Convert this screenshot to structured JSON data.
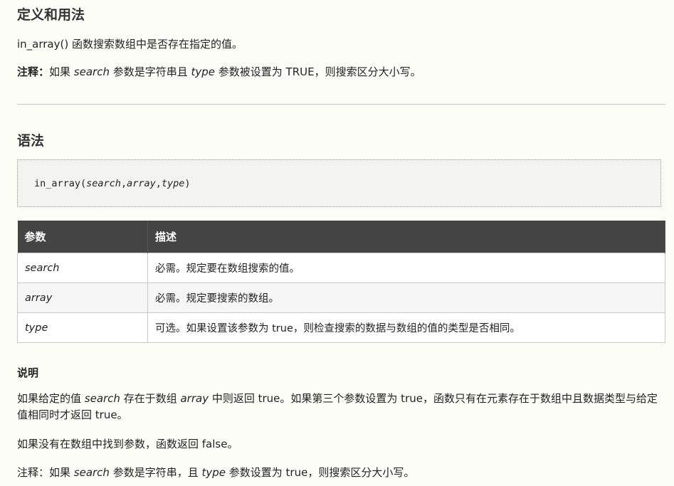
{
  "definition": {
    "heading": "定义和用法",
    "intro": "in_array() 函数搜索数组中是否存在指定的值。",
    "note": {
      "label": "注释：",
      "part1": "如果 ",
      "search": "search",
      "part2": " 参数是字符串且 ",
      "type": "type",
      "part3": " 参数被设置为 TRUE，则搜索区分大小写。"
    }
  },
  "syntax": {
    "heading": "语法",
    "code": {
      "fn": "in_array(",
      "arg1": "search",
      "sep1": ",",
      "arg2": "array",
      "sep2": ",",
      "arg3": "type",
      "close": ")"
    }
  },
  "params_table": {
    "headers": [
      "参数",
      "描述"
    ],
    "rows": [
      {
        "name": "search",
        "desc": "必需。规定要在数组搜索的值。"
      },
      {
        "name": "array",
        "desc": "必需。规定要搜索的数组。"
      },
      {
        "name": "type",
        "desc": "可选。如果设置该参数为 true，则检查搜索的数据与数组的值的类型是否相同。"
      }
    ]
  },
  "description": {
    "heading": "说明",
    "p1": {
      "part1": "如果给定的值 ",
      "search": "search",
      "part2": " 存在于数组 ",
      "array": "array",
      "part3": " 中则返回 true。如果第三个参数设置为 true，函数只有在元素存在于数组中且数据类型与给定值相同时才返回 true。"
    },
    "p2": "如果没有在数组中找到参数，函数返回 false。",
    "p3": {
      "part1": "注释：如果 ",
      "search": "search",
      "part2": " 参数是字符串，且 ",
      "type": "type",
      "part3": " 参数设置为 true，则搜索区分大小写。"
    }
  }
}
